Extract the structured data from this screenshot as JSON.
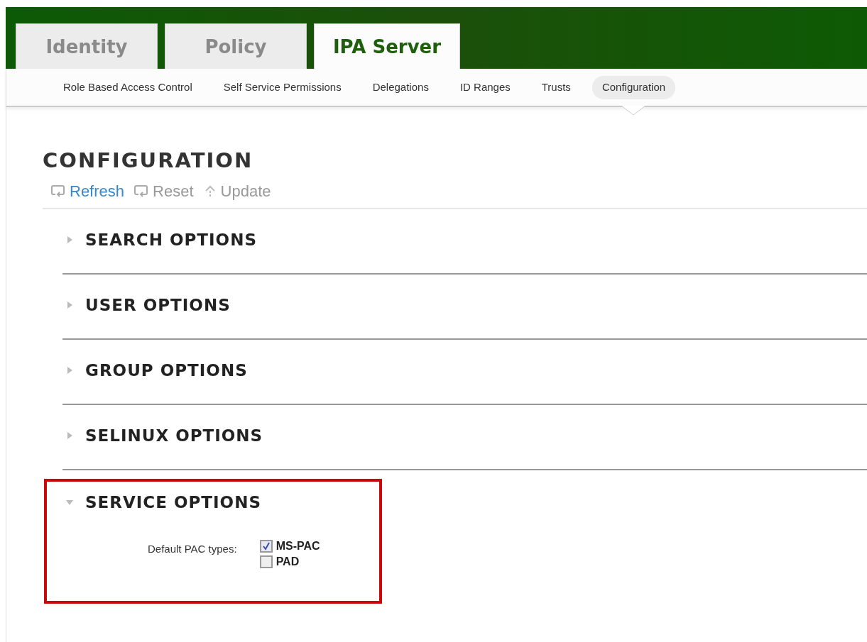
{
  "top_tabs": [
    {
      "label": "Identity",
      "selected": false
    },
    {
      "label": "Policy",
      "selected": false
    },
    {
      "label": "IPA Server",
      "selected": true
    }
  ],
  "sub_nav": [
    {
      "label": "Role Based Access Control",
      "selected": false
    },
    {
      "label": "Self Service Permissions",
      "selected": false
    },
    {
      "label": "Delegations",
      "selected": false
    },
    {
      "label": "ID Ranges",
      "selected": false
    },
    {
      "label": "Trusts",
      "selected": false
    },
    {
      "label": "Configuration",
      "selected": true
    }
  ],
  "page_title": "CONFIGURATION",
  "actions": [
    {
      "label": "Refresh",
      "kind": "refresh",
      "disabled": false
    },
    {
      "label": "Reset",
      "kind": "reset",
      "disabled": true
    },
    {
      "label": "Update",
      "kind": "update",
      "disabled": true
    }
  ],
  "sections": [
    {
      "title": "SEARCH OPTIONS",
      "expanded": false,
      "highlighted": false
    },
    {
      "title": "USER OPTIONS",
      "expanded": false,
      "highlighted": false
    },
    {
      "title": "GROUP OPTIONS",
      "expanded": false,
      "highlighted": false
    },
    {
      "title": "SELINUX OPTIONS",
      "expanded": false,
      "highlighted": false
    },
    {
      "title": "SERVICE OPTIONS",
      "expanded": true,
      "highlighted": true,
      "fields": [
        {
          "label": "Default PAC types:",
          "options": [
            {
              "label": "MS-PAC",
              "checked": true
            },
            {
              "label": "PAD",
              "checked": false
            }
          ]
        }
      ]
    }
  ]
}
